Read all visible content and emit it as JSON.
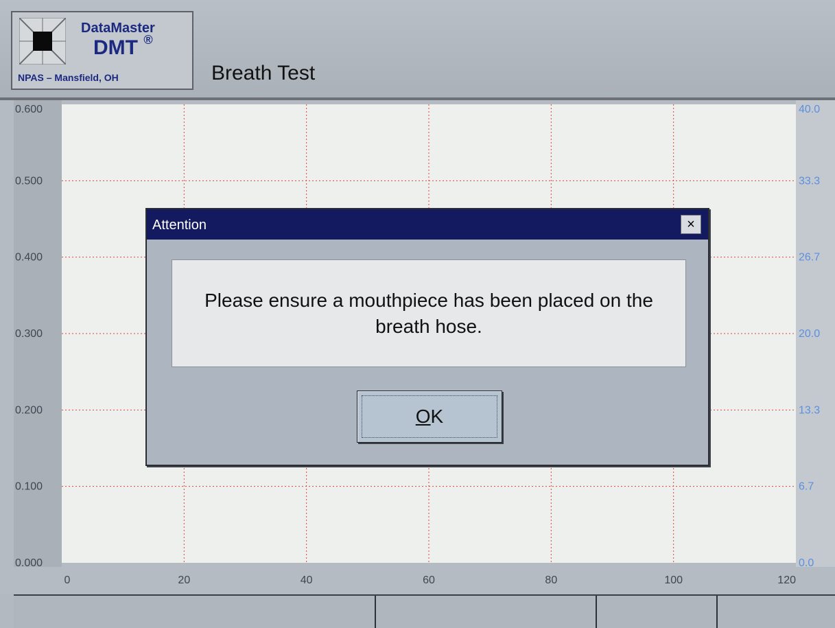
{
  "header": {
    "logo_name": "DataMaster",
    "logo_model": "DMT",
    "logo_mark": "®",
    "logo_location": "NPAS – Mansfield, OH",
    "title": "Breath Test"
  },
  "chart_data": {
    "type": "line",
    "x_ticks": [
      "0",
      "20",
      "40",
      "60",
      "80",
      "100",
      "120"
    ],
    "y_left_ticks": [
      "0.000",
      "0.100",
      "0.200",
      "0.300",
      "0.400",
      "0.500",
      "0.600"
    ],
    "y_right_ticks": [
      "0.0",
      "6.7",
      "13.3",
      "20.0",
      "26.7",
      "33.3",
      "40.0"
    ],
    "xlim": [
      0,
      120
    ],
    "ylim_left": [
      0,
      0.6
    ],
    "ylim_right": [
      0,
      40
    ],
    "grid": true,
    "series": []
  },
  "dialog": {
    "title": "Attention",
    "close_symbol": "×",
    "message": "Please ensure a mouthpiece has been placed on the breath hose.",
    "ok_label": "OK",
    "ok_mnemonic": "O"
  },
  "status_bar": {
    "cells": [
      "",
      "",
      "",
      ""
    ]
  },
  "colors": {
    "dialog_titlebar": "#131a5f",
    "grid_line": "#e0403a",
    "right_axis_text": "#5b8fe0",
    "plot_background": "#eef0ee"
  }
}
